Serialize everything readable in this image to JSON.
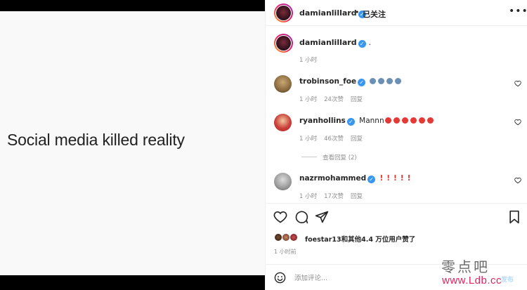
{
  "post": {
    "image_text": "Social media killed reality"
  },
  "header": {
    "username": "damianlillard",
    "dot": "•",
    "follow_status": "已关注",
    "more": "•••"
  },
  "caption": {
    "username": "damianlillard",
    "text": ".",
    "time": "1 小时"
  },
  "comments": [
    {
      "username": "trobinson_foe",
      "text": "",
      "time": "1 小时",
      "likes": "24次赞",
      "reply": "回复",
      "emojis": [
        "#6b8fb5",
        "#6b8fb5",
        "#6b8fb5",
        "#6b8fb5"
      ]
    },
    {
      "username": "ryanhollins",
      "text": "Mannn",
      "time": "1 小时",
      "likes": "46次赞",
      "reply": "回复",
      "emojis": [
        "#e53935",
        "#e53935",
        "#e53935",
        "#e53935",
        "#e53935",
        "#e53935"
      ]
    },
    {
      "username": "nazrmohammed",
      "text": "",
      "time": "1 小时",
      "likes": "17次赞",
      "reply": "回复",
      "emojis": [
        "#e53935",
        "#e53935",
        "#e53935",
        "#e53935",
        "#e53935"
      ]
    }
  ],
  "view_replies": "查看回复 (2)",
  "likes_summary": "foestar13和其他4.4 万位用户赞了",
  "post_time": "1 小时前",
  "comment_box": {
    "placeholder": "添加评论...",
    "post_label": "发布"
  },
  "watermark": {
    "line1": "零点吧",
    "line2": "www.Ldb.cc"
  },
  "colors": {
    "verified": "#3897f0",
    "muted": "#8e8e8e",
    "text": "#262626"
  }
}
